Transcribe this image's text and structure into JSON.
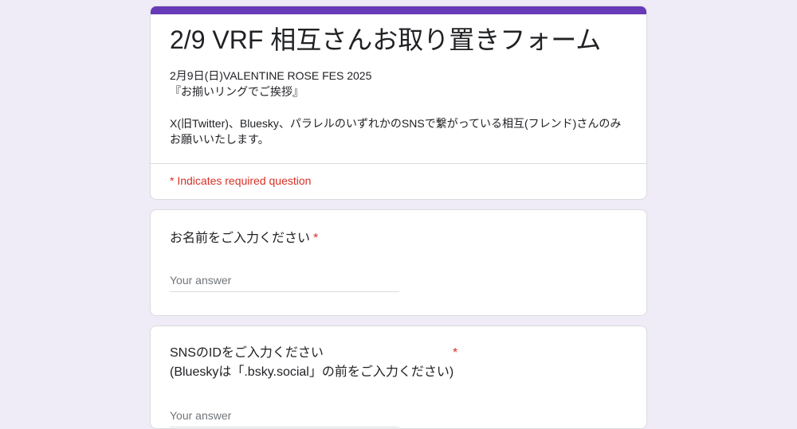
{
  "form": {
    "title": "2/9 VRF 相互さんお取り置きフォーム",
    "description_lines": [
      "2月9日(日)VALENTINE ROSE FES 2025",
      "『お揃いリングでご挨拶』",
      "",
      "X(旧Twitter)、Bluesky、パラレルのいずれかのSNSで繋がっている相互(フレンド)さんのみ",
      "お願いいたします。"
    ],
    "required_note": "* Indicates required question",
    "accent_color": "#673ab7",
    "required_color": "#d93025"
  },
  "questions": [
    {
      "title": "お名前をご入力ください",
      "required_mark": "*",
      "placeholder": "Your answer"
    },
    {
      "title_line1": "SNSのIDをご入力ください",
      "title_line2": "(Blueskyは「.bsky.social」の前をご入力ください)",
      "required_mark": "*",
      "placeholder": "Your answer"
    }
  ]
}
